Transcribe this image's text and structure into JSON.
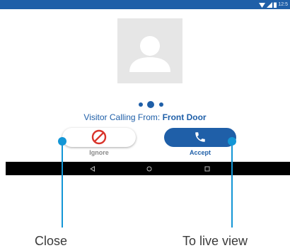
{
  "status_bar": {
    "time": "12:5",
    "icons": [
      "wifi-icon",
      "cell-signal-icon",
      "battery-icon"
    ]
  },
  "call": {
    "caller_prefix": "Visitor Calling From:",
    "caller_location": "Front Door"
  },
  "buttons": {
    "ignore_label": "Ignore",
    "accept_label": "Accept"
  },
  "nav_bar": {
    "icons": [
      "back-icon",
      "home-icon",
      "recents-icon"
    ]
  },
  "callouts": {
    "ignore": "Close",
    "accept": "To live view"
  },
  "colors": {
    "accent": "#1f5fa8",
    "ignore_icon": "#d9342b",
    "callout": "#1396d6"
  }
}
